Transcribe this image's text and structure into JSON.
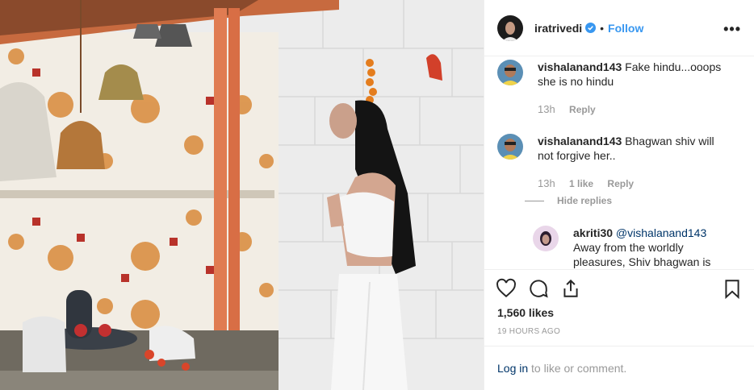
{
  "post": {
    "author": "iratrivedi",
    "follow_label": "Follow",
    "separator": "•",
    "more_label": "•••",
    "likes": "1,560 likes",
    "posted_ago": "19 HOURS AGO",
    "login_link": "Log in",
    "login_suffix": " to like or comment."
  },
  "comments": [
    {
      "user": "vishalanand143",
      "text": " Fake hindu...ooops she is no hindu",
      "time": "13h",
      "likes": "",
      "reply_label": "Reply"
    },
    {
      "user": "vishalanand143",
      "text": " Bhagwan shiv will not forgive her..",
      "time": "13h",
      "likes": "1 like",
      "reply_label": "Reply",
      "hide_replies": "Hide replies"
    }
  ],
  "reply": {
    "user": "akriti30",
    "mention": " @vishalanand143",
    "text": "Away from the worldly pleasures, Shiv bhagwan is"
  },
  "colors": {
    "accent": "#3897f0",
    "link": "#003569",
    "muted": "#999999",
    "verified": "#3897f0"
  },
  "icons": [
    "verified-badge-icon",
    "more-options-icon",
    "heart-icon",
    "comment-icon",
    "share-icon",
    "bookmark-icon"
  ]
}
